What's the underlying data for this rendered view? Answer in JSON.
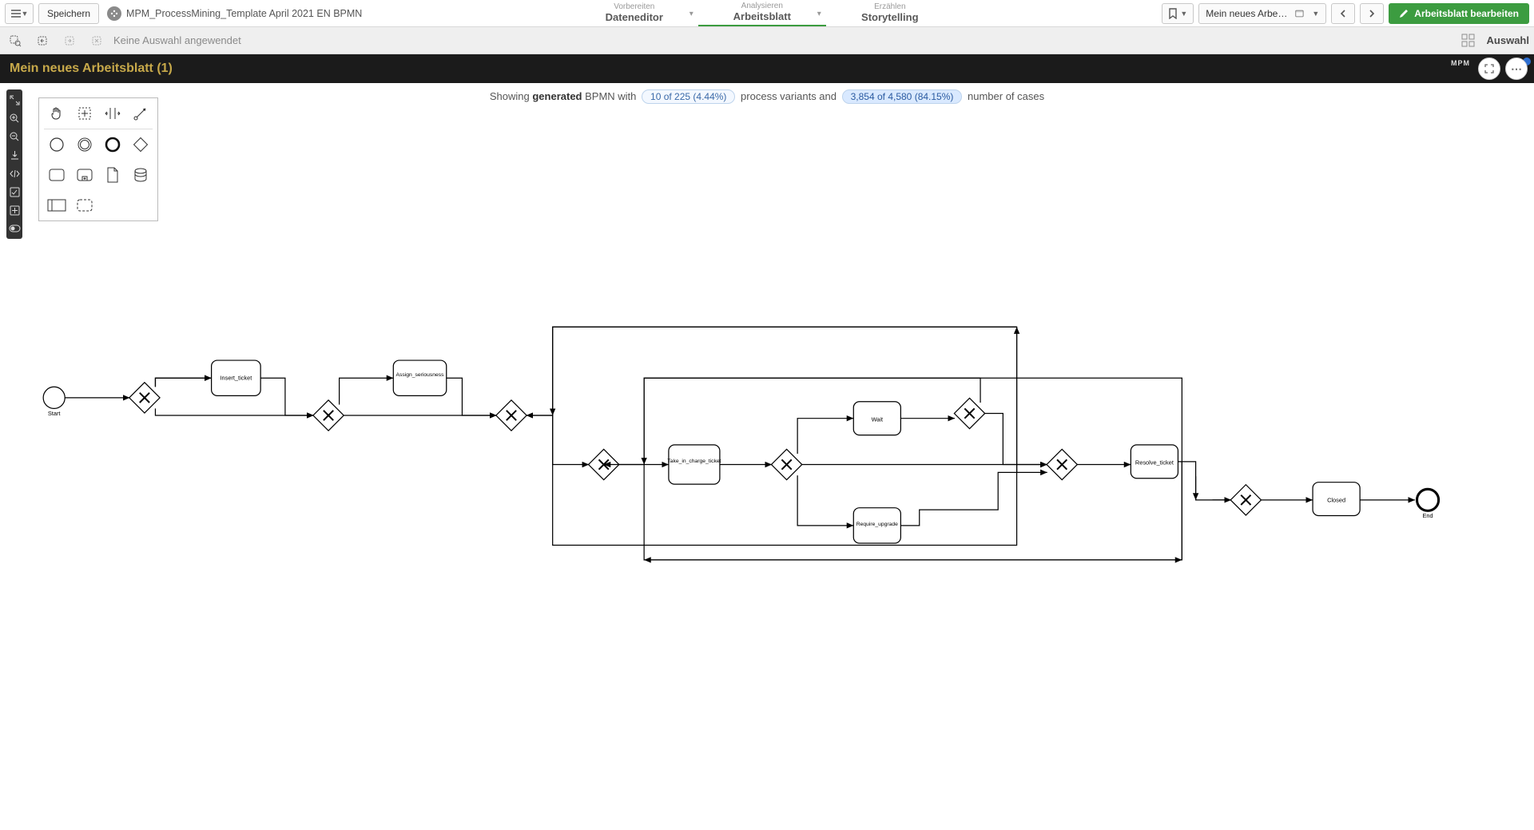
{
  "header": {
    "save_label": "Speichern",
    "app_title": "MPM_ProcessMining_Template April 2021 EN BPMN",
    "tabs": [
      {
        "small": "Vorbereiten",
        "big": "Dateneditor",
        "chevron": true,
        "active": false
      },
      {
        "small": "Analysieren",
        "big": "Arbeitsblatt",
        "chevron": true,
        "active": true
      },
      {
        "small": "Erzählen",
        "big": "Storytelling",
        "chevron": false,
        "active": false
      }
    ],
    "sheet_selector": "Mein neues Arbeitsblat...",
    "edit_button": "Arbeitsblatt bearbeiten"
  },
  "selection_bar": {
    "message": "Keine Auswahl angewendet",
    "right_label": "Auswahl"
  },
  "sheet": {
    "title": "Mein neues Arbeitsblatt (1)",
    "badge": "MPM"
  },
  "info": {
    "prefix": "Showing ",
    "generated": "generated",
    "after_gen": " BPMN with ",
    "chip_variants": "10 of 225 (4.44%)",
    "mid1": " process variants and ",
    "chip_cases": "3,854 of 4,580 (84.15%)",
    "suffix": " number of cases"
  },
  "bpmn": {
    "start_label": "Start",
    "end_label": "End",
    "tasks": {
      "insert": "Insert_ticket",
      "assign": "Assign_seriousness",
      "take": "Take_in_charge_ticket",
      "wait": "Wait",
      "require": "Require_upgrade",
      "resolve": "Resolve_ticket",
      "closed": "Closed"
    }
  }
}
